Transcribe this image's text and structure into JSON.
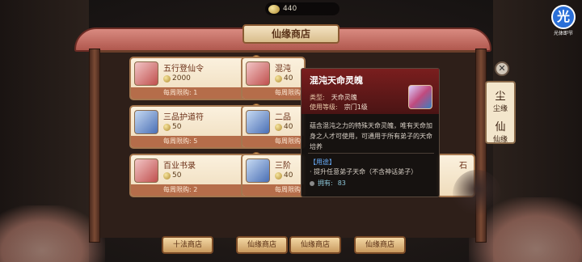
{
  "top_bar": {
    "currency_amount": "440"
  },
  "badge": {
    "glyph": "光",
    "label": "光体即节"
  },
  "shop": {
    "title": "仙缘商店"
  },
  "cards": [
    {
      "name": "五行登仙令",
      "price": "2000",
      "limit": "每周限购: 1",
      "thumb": "red"
    },
    {
      "name": "混沌",
      "price": "40",
      "limit": "每周限购",
      "thumb": "red"
    },
    {
      "name": "三品护道符",
      "price": "50",
      "limit": "每周限购: 5",
      "thumb": "blue"
    },
    {
      "name": "二品",
      "price": "40",
      "limit": "每周限购",
      "thumb": "blue"
    },
    {
      "name": "百业书录",
      "price": "50",
      "limit": "每周限购: 2",
      "thumb": "red"
    },
    {
      "name": "三阶",
      "price": "40",
      "limit": "每周限购",
      "thumb": "blue"
    }
  ],
  "hidden_card_fragment": "石",
  "tabs": [
    "十法商店",
    "仙缘商店",
    "仙缘商店",
    "仙缘商店"
  ],
  "side_panel": {
    "items": [
      {
        "glyph": "尘",
        "label": "尘缘"
      },
      {
        "glyph": "仙",
        "label": "仙缘"
      }
    ]
  },
  "tooltip": {
    "title": "混沌天命灵魄",
    "type_label": "类型:",
    "type_value": "天命灵魄",
    "level_label": "使用等级:",
    "level_value": "宗门1级",
    "description": "蕴含混沌之力的特殊天命灵魄，唯有天命加身之人才可使用，可通用于所有弟子的天命培养",
    "use_label": "【用途】",
    "use_text": "· 提升任意弟子天命（不含神话弟子）",
    "owned_label": "拥有:",
    "owned_value": "83"
  }
}
